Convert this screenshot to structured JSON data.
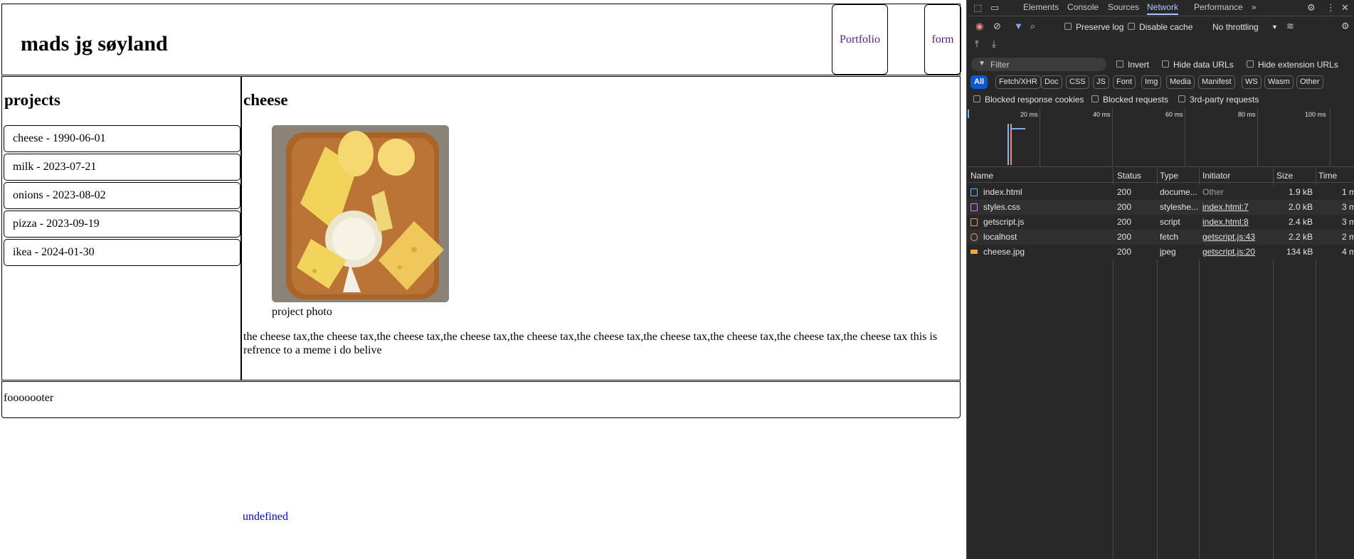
{
  "page": {
    "site_title": "mads jg søyland",
    "nav": {
      "portfolio": "Portfolio",
      "form": "form"
    },
    "sidebar_title": "projects",
    "projects": [
      "cheese - 1990-06-01",
      "milk - 2023-07-21",
      "onions - 2023-08-02",
      "pizza - 2023-09-19",
      "ikea - 2024-01-30"
    ],
    "main_title": "cheese",
    "photo_caption": "project photo",
    "description": "the cheese tax,the cheese tax,the cheese tax,the cheese tax,the cheese tax,the cheese tax,the cheese tax,the cheese tax,the cheese tax,the cheese tax this is refrence to a meme i do belive",
    "footer": "fooooooter",
    "undefined_link": "undefined"
  },
  "devtools": {
    "tabs": [
      "Elements",
      "Console",
      "Sources",
      "Network",
      "Performance"
    ],
    "active_tab": "Network",
    "more_tabs": "»",
    "preserve_log": "Preserve log",
    "disable_cache": "Disable cache",
    "throttling": "No throttling",
    "filter_placeholder": "Filter",
    "invert": "Invert",
    "hide_data_urls": "Hide data URLs",
    "hide_extension_urls": "Hide extension URLs",
    "type_filters": [
      "All",
      "Fetch/XHR",
      "Doc",
      "CSS",
      "JS",
      "Font",
      "Img",
      "Media",
      "Manifest",
      "WS",
      "Wasm",
      "Other"
    ],
    "blocked_response_cookies": "Blocked response cookies",
    "blocked_requests": "Blocked requests",
    "third_party_requests": "3rd-party requests",
    "timeline_ticks": [
      "20 ms",
      "40 ms",
      "60 ms",
      "80 ms",
      "100 ms"
    ],
    "columns": [
      "Name",
      "Status",
      "Type",
      "Initiator",
      "Size",
      "Time"
    ],
    "requests": [
      {
        "name": "index.html",
        "status": "200",
        "type": "docume...",
        "initiator": "Other",
        "size": "1.9 kB",
        "time": "1 m",
        "icon_color": "#7cacf8"
      },
      {
        "name": "styles.css",
        "status": "200",
        "type": "styleshe...",
        "initiator": "index.html:7",
        "size": "2.0 kB",
        "time": "3 m",
        "icon_color": "#c58af9"
      },
      {
        "name": "getscript.js",
        "status": "200",
        "type": "script",
        "initiator": "index.html:8",
        "size": "2.4 kB",
        "time": "3 m",
        "icon_color": "#f29b6b"
      },
      {
        "name": "localhost",
        "status": "200",
        "type": "fetch",
        "initiator": "getscript.js:43",
        "size": "2.2 kB",
        "time": "2 m",
        "icon_color": "#f29b6b"
      },
      {
        "name": "cheese.jpg",
        "status": "200",
        "type": "jpeg",
        "initiator": "getscript.js:20",
        "size": "134 kB",
        "time": "4 m",
        "icon_color": "#f2a93b"
      }
    ]
  }
}
